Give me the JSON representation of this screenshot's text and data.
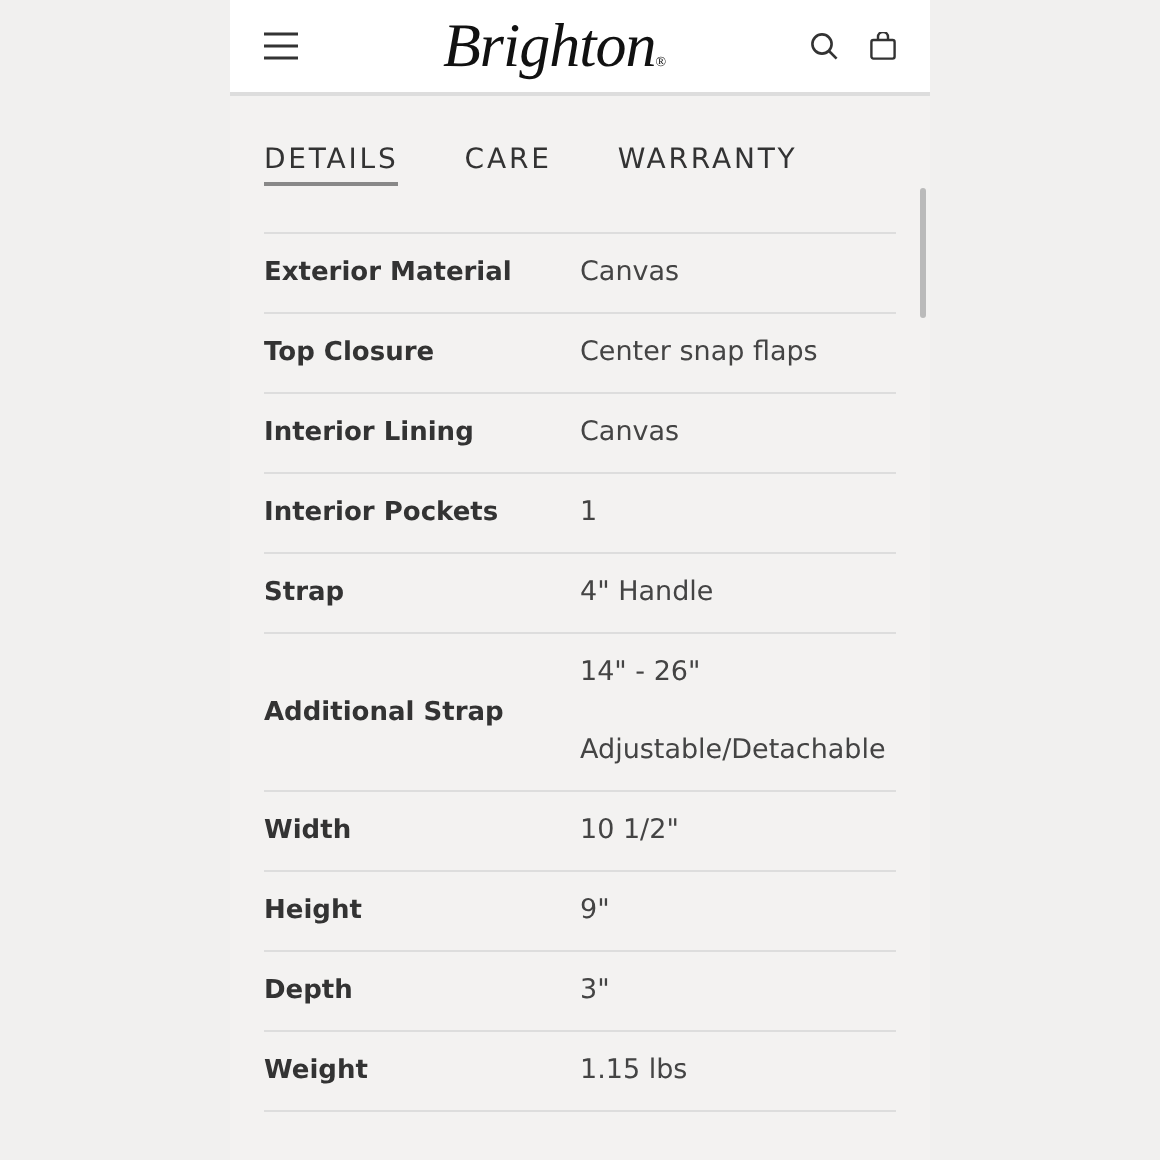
{
  "header": {
    "logo": "Brighton",
    "logo_mark": "®"
  },
  "tabs": [
    {
      "label": "DETAILS",
      "selected": true
    },
    {
      "label": "CARE",
      "selected": false
    },
    {
      "label": "WARRANTY",
      "selected": false
    }
  ],
  "specs": [
    {
      "name": "Exterior Material",
      "values": [
        "Canvas"
      ]
    },
    {
      "name": "Top Closure",
      "values": [
        "Center snap flaps"
      ]
    },
    {
      "name": "Interior Lining",
      "values": [
        "Canvas"
      ]
    },
    {
      "name": "Interior Pockets",
      "values": [
        "1"
      ]
    },
    {
      "name": "Strap",
      "values": [
        "4\" Handle"
      ]
    },
    {
      "name": "Additional Strap",
      "values": [
        "14\" - 26\"",
        "Adjustable/Detachable"
      ]
    },
    {
      "name": "Width",
      "values": [
        "10 1/2\""
      ]
    },
    {
      "name": "Height",
      "values": [
        "9\""
      ]
    },
    {
      "name": "Depth",
      "values": [
        "3\""
      ]
    },
    {
      "name": "Weight",
      "values": [
        "1.15 lbs"
      ]
    }
  ]
}
